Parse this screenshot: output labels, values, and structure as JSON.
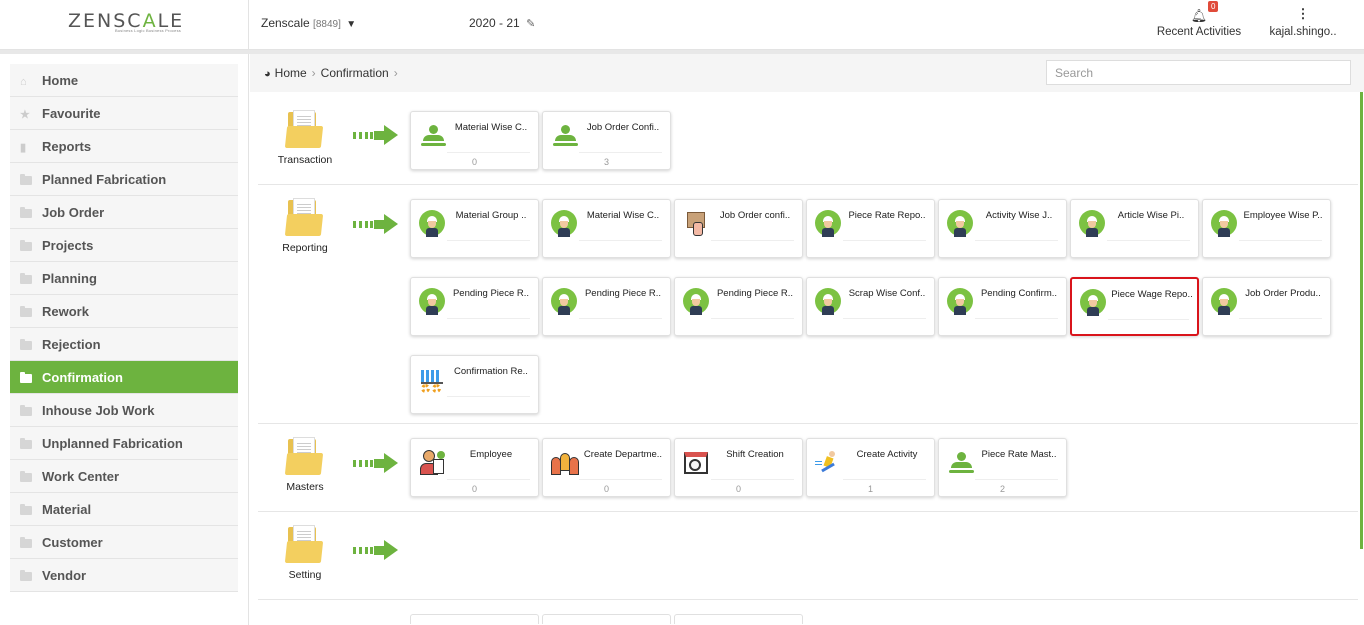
{
  "header": {
    "logo_left": "ZENSC",
    "logo_mid": "A",
    "logo_right": "LE",
    "tagline": "Business Logic Business Process",
    "company": "Zenscale",
    "company_code": "[8849]",
    "year": "2020 - 21",
    "recent_label": "Recent Activities",
    "recent_badge": "0",
    "user_label": "kajal.shingo.."
  },
  "sidebar": {
    "items": [
      {
        "label": "Home",
        "icon": "home-icon"
      },
      {
        "label": "Favourite",
        "icon": "star-icon"
      },
      {
        "label": "Reports",
        "icon": "file-icon"
      },
      {
        "label": "Planned Fabrication",
        "icon": "folder-icon"
      },
      {
        "label": "Job Order",
        "icon": "folder-icon"
      },
      {
        "label": "Projects",
        "icon": "folder-icon"
      },
      {
        "label": "Planning",
        "icon": "folder-icon"
      },
      {
        "label": "Rework",
        "icon": "folder-icon"
      },
      {
        "label": "Rejection",
        "icon": "folder-icon"
      },
      {
        "label": "Confirmation",
        "icon": "folder-icon",
        "active": true
      },
      {
        "label": "Inhouse Job Work",
        "icon": "folder-icon"
      },
      {
        "label": "Unplanned Fabrication",
        "icon": "folder-icon"
      },
      {
        "label": "Work Center",
        "icon": "folder-icon"
      },
      {
        "label": "Material",
        "icon": "folder-icon"
      },
      {
        "label": "Customer",
        "icon": "folder-icon"
      },
      {
        "label": "Vendor",
        "icon": "folder-icon"
      }
    ]
  },
  "breadcrumb": {
    "home": "Home",
    "current": "Confirmation"
  },
  "search": {
    "placeholder": "Search"
  },
  "sections": {
    "transaction": {
      "label": "Transaction",
      "cards": [
        {
          "title": "Material Wise C..",
          "count": "0",
          "icon": "person-icon"
        },
        {
          "title": "Job Order Confi..",
          "count": "3",
          "icon": "person-icon"
        }
      ]
    },
    "reporting": {
      "label": "Reporting",
      "cards": [
        {
          "title": "Material Group ..",
          "count": "",
          "icon": "worker-icon"
        },
        {
          "title": "Material Wise C..",
          "count": "",
          "icon": "worker-icon"
        },
        {
          "title": "Job Order confi..",
          "count": "",
          "icon": "package-icon"
        },
        {
          "title": "Piece Rate Repo..",
          "count": "",
          "icon": "worker-icon"
        },
        {
          "title": "Activity Wise J..",
          "count": "",
          "icon": "worker-icon"
        },
        {
          "title": "Article Wise Pi..",
          "count": "",
          "icon": "worker-icon"
        },
        {
          "title": "Employee Wise P..",
          "count": "",
          "icon": "worker-icon"
        },
        {
          "title": "Pending Piece R..",
          "count": "",
          "icon": "worker-icon"
        },
        {
          "title": "Pending Piece R..",
          "count": "",
          "icon": "worker-icon"
        },
        {
          "title": "Pending Piece R..",
          "count": "",
          "icon": "worker-icon"
        },
        {
          "title": "Scrap Wise Conf..",
          "count": "",
          "icon": "worker-icon"
        },
        {
          "title": "Pending Confirm..",
          "count": "",
          "icon": "worker-icon"
        },
        {
          "title": "Piece Wage Repo..",
          "count": "",
          "icon": "worker-icon",
          "highlight": true
        },
        {
          "title": "Job Order Produ..",
          "count": "",
          "icon": "worker-icon"
        },
        {
          "title": "Confirmation Re..",
          "count": "",
          "icon": "chart-gear-icon"
        }
      ]
    },
    "masters": {
      "label": "Masters",
      "cards": [
        {
          "title": "Employee",
          "count": "0",
          "icon": "employee-icon"
        },
        {
          "title": "Create Departme..",
          "count": "0",
          "icon": "department-icon"
        },
        {
          "title": "Shift Creation",
          "count": "0",
          "icon": "calendar-clock-icon"
        },
        {
          "title": "Create Activity",
          "count": "1",
          "icon": "runner-icon"
        },
        {
          "title": "Piece Rate Mast..",
          "count": "2",
          "icon": "person-icon"
        }
      ]
    },
    "setting": {
      "label": "Setting",
      "cards": []
    }
  },
  "colors": {
    "accent": "#6db33f",
    "highlight": "#d9141b",
    "badge": "#e04b3a"
  }
}
